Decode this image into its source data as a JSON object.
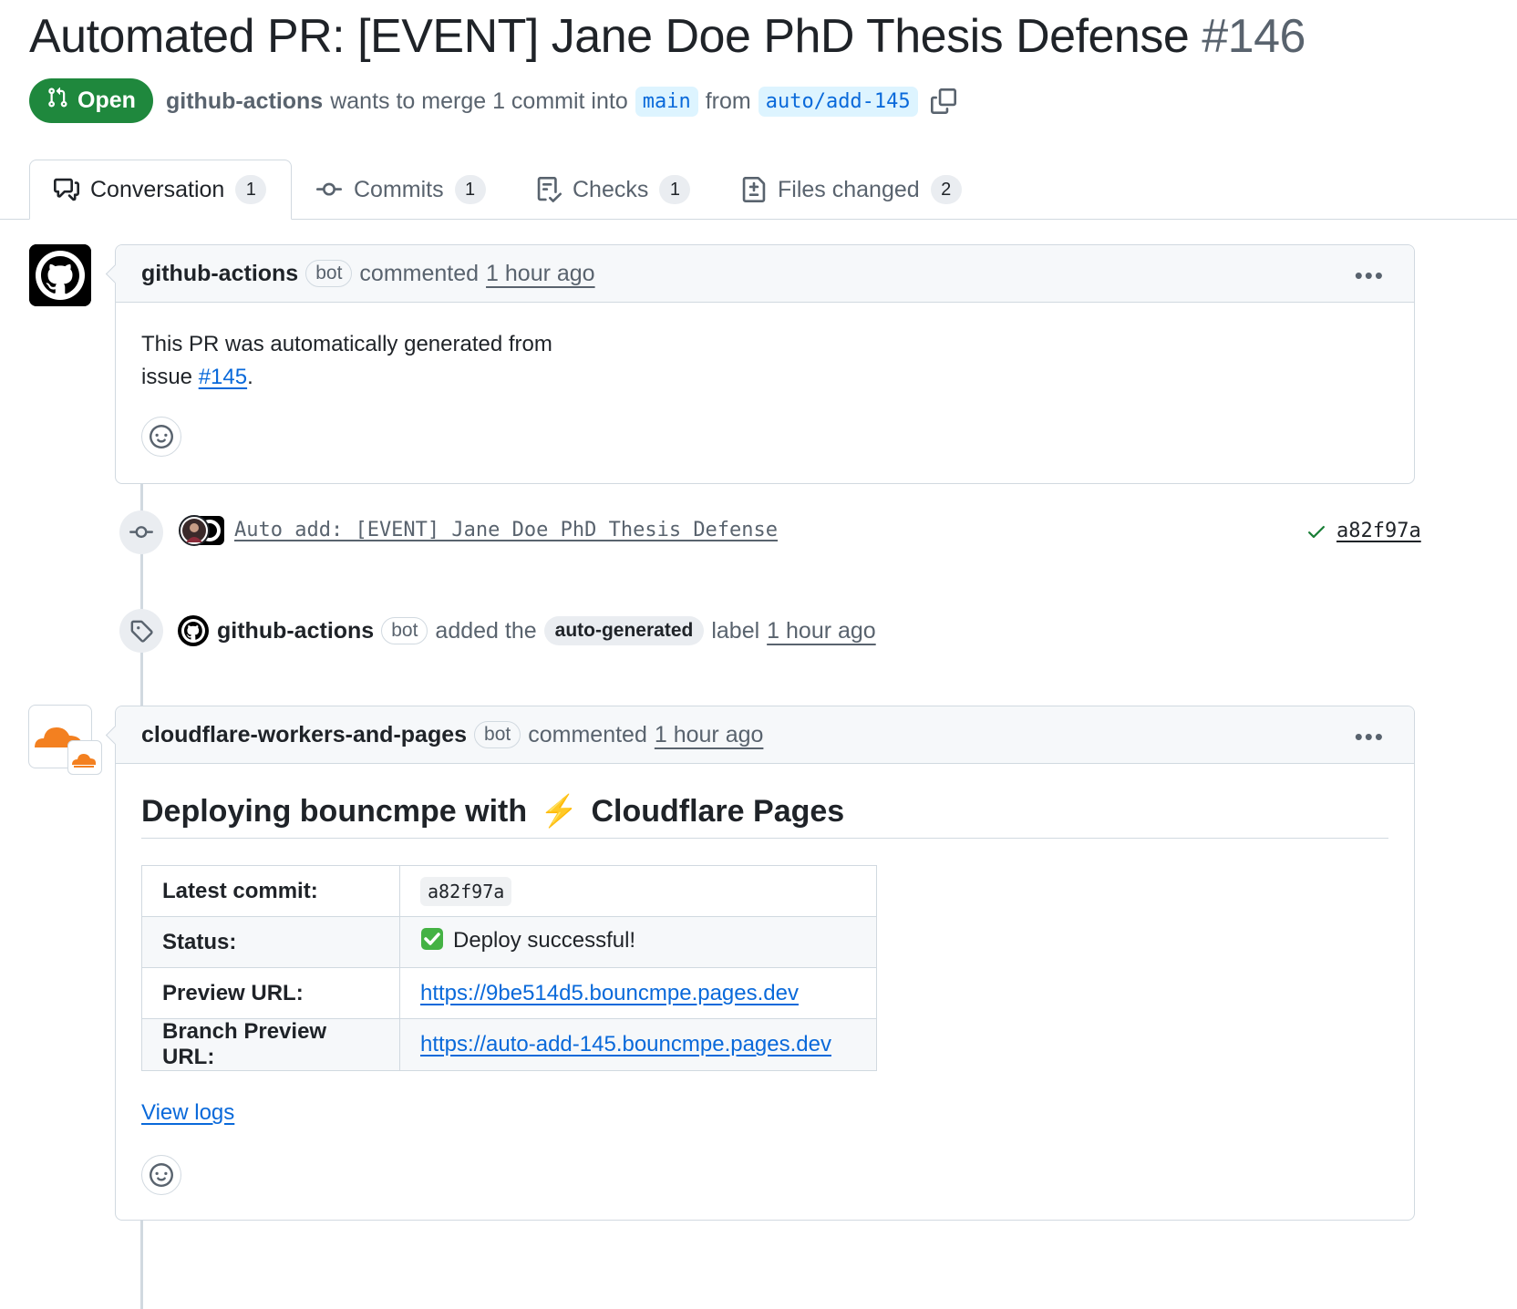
{
  "pr": {
    "title": "Automated PR: [EVENT] Jane Doe PhD Thesis Defense",
    "number": "#146",
    "state": "Open",
    "author": "github-actions",
    "merge_text": "wants to merge 1 commit into",
    "base_branch": "main",
    "from_text": "from",
    "head_branch": "auto/add-145"
  },
  "tabs": [
    {
      "label": "Conversation",
      "count": "1",
      "icon": "comment-discussion-icon"
    },
    {
      "label": "Commits",
      "count": "1",
      "icon": "git-commit-icon"
    },
    {
      "label": "Checks",
      "count": "1",
      "icon": "checklist-icon"
    },
    {
      "label": "Files changed",
      "count": "2",
      "icon": "file-diff-icon"
    }
  ],
  "comment1": {
    "author": "github-actions",
    "bot": "bot",
    "action": "commented",
    "time": "1 hour ago",
    "body_line1": "This PR was automatically generated from",
    "body_line2_prefix": "issue",
    "issue_link": "#145",
    "body_suffix": "."
  },
  "commit_event": {
    "message": "Auto add: [EVENT] Jane Doe PhD Thesis Defense",
    "sha": "a82f97a",
    "status": "success"
  },
  "label_event": {
    "actor": "github-actions",
    "bot": "bot",
    "action": "added the",
    "label": "auto-generated",
    "suffix": "label",
    "time": "1 hour ago"
  },
  "comment2": {
    "author": "cloudflare-workers-and-pages",
    "bot": "bot",
    "action": "commented",
    "time": "1 hour ago",
    "heading_prefix": "Deploying bouncmpe with",
    "heading_emoji": "⚡️",
    "heading_suffix": "Cloudflare Pages",
    "rows": [
      {
        "key": "Latest commit:",
        "value": "a82f97a"
      },
      {
        "key": "Status:",
        "value": "Deploy successful!"
      },
      {
        "key": "Preview URL:",
        "value": "https://9be514d5.bouncmpe.pages.dev"
      },
      {
        "key": "Branch Preview URL:",
        "value": "https://auto-add-145.bouncmpe.pages.dev"
      }
    ],
    "view_logs": "View logs"
  },
  "colors": {
    "open_green": "#1f883d",
    "link_blue": "#0969da",
    "branch_bg": "#ddf4ff",
    "cloudflare_orange": "#f38020"
  }
}
